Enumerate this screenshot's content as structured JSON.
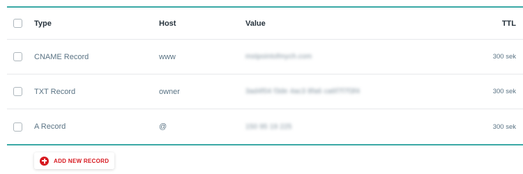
{
  "table": {
    "columns": {
      "type": "Type",
      "host": "Host",
      "value": "Value",
      "ttl": "TTL"
    },
    "rows": [
      {
        "type": "CNAME Record",
        "host": "www",
        "value": "mstpointofmych.com",
        "ttl": "300 sek"
      },
      {
        "type": "TXT Record",
        "host": "owner",
        "value": "3ad4f04 f3de 4ac3 8fa6 ca6f7f7f3f4",
        "ttl": "300 sek"
      },
      {
        "type": "A Record",
        "host": "@",
        "value": "150 95 19 225",
        "ttl": "300 sek"
      }
    ]
  },
  "actions": {
    "add_record_label": "ADD NEW RECORD"
  },
  "colors": {
    "accent_rule": "#3aa8a5",
    "add_button_red": "#d71920"
  },
  "icons": {
    "add": "plus-circle-icon"
  }
}
